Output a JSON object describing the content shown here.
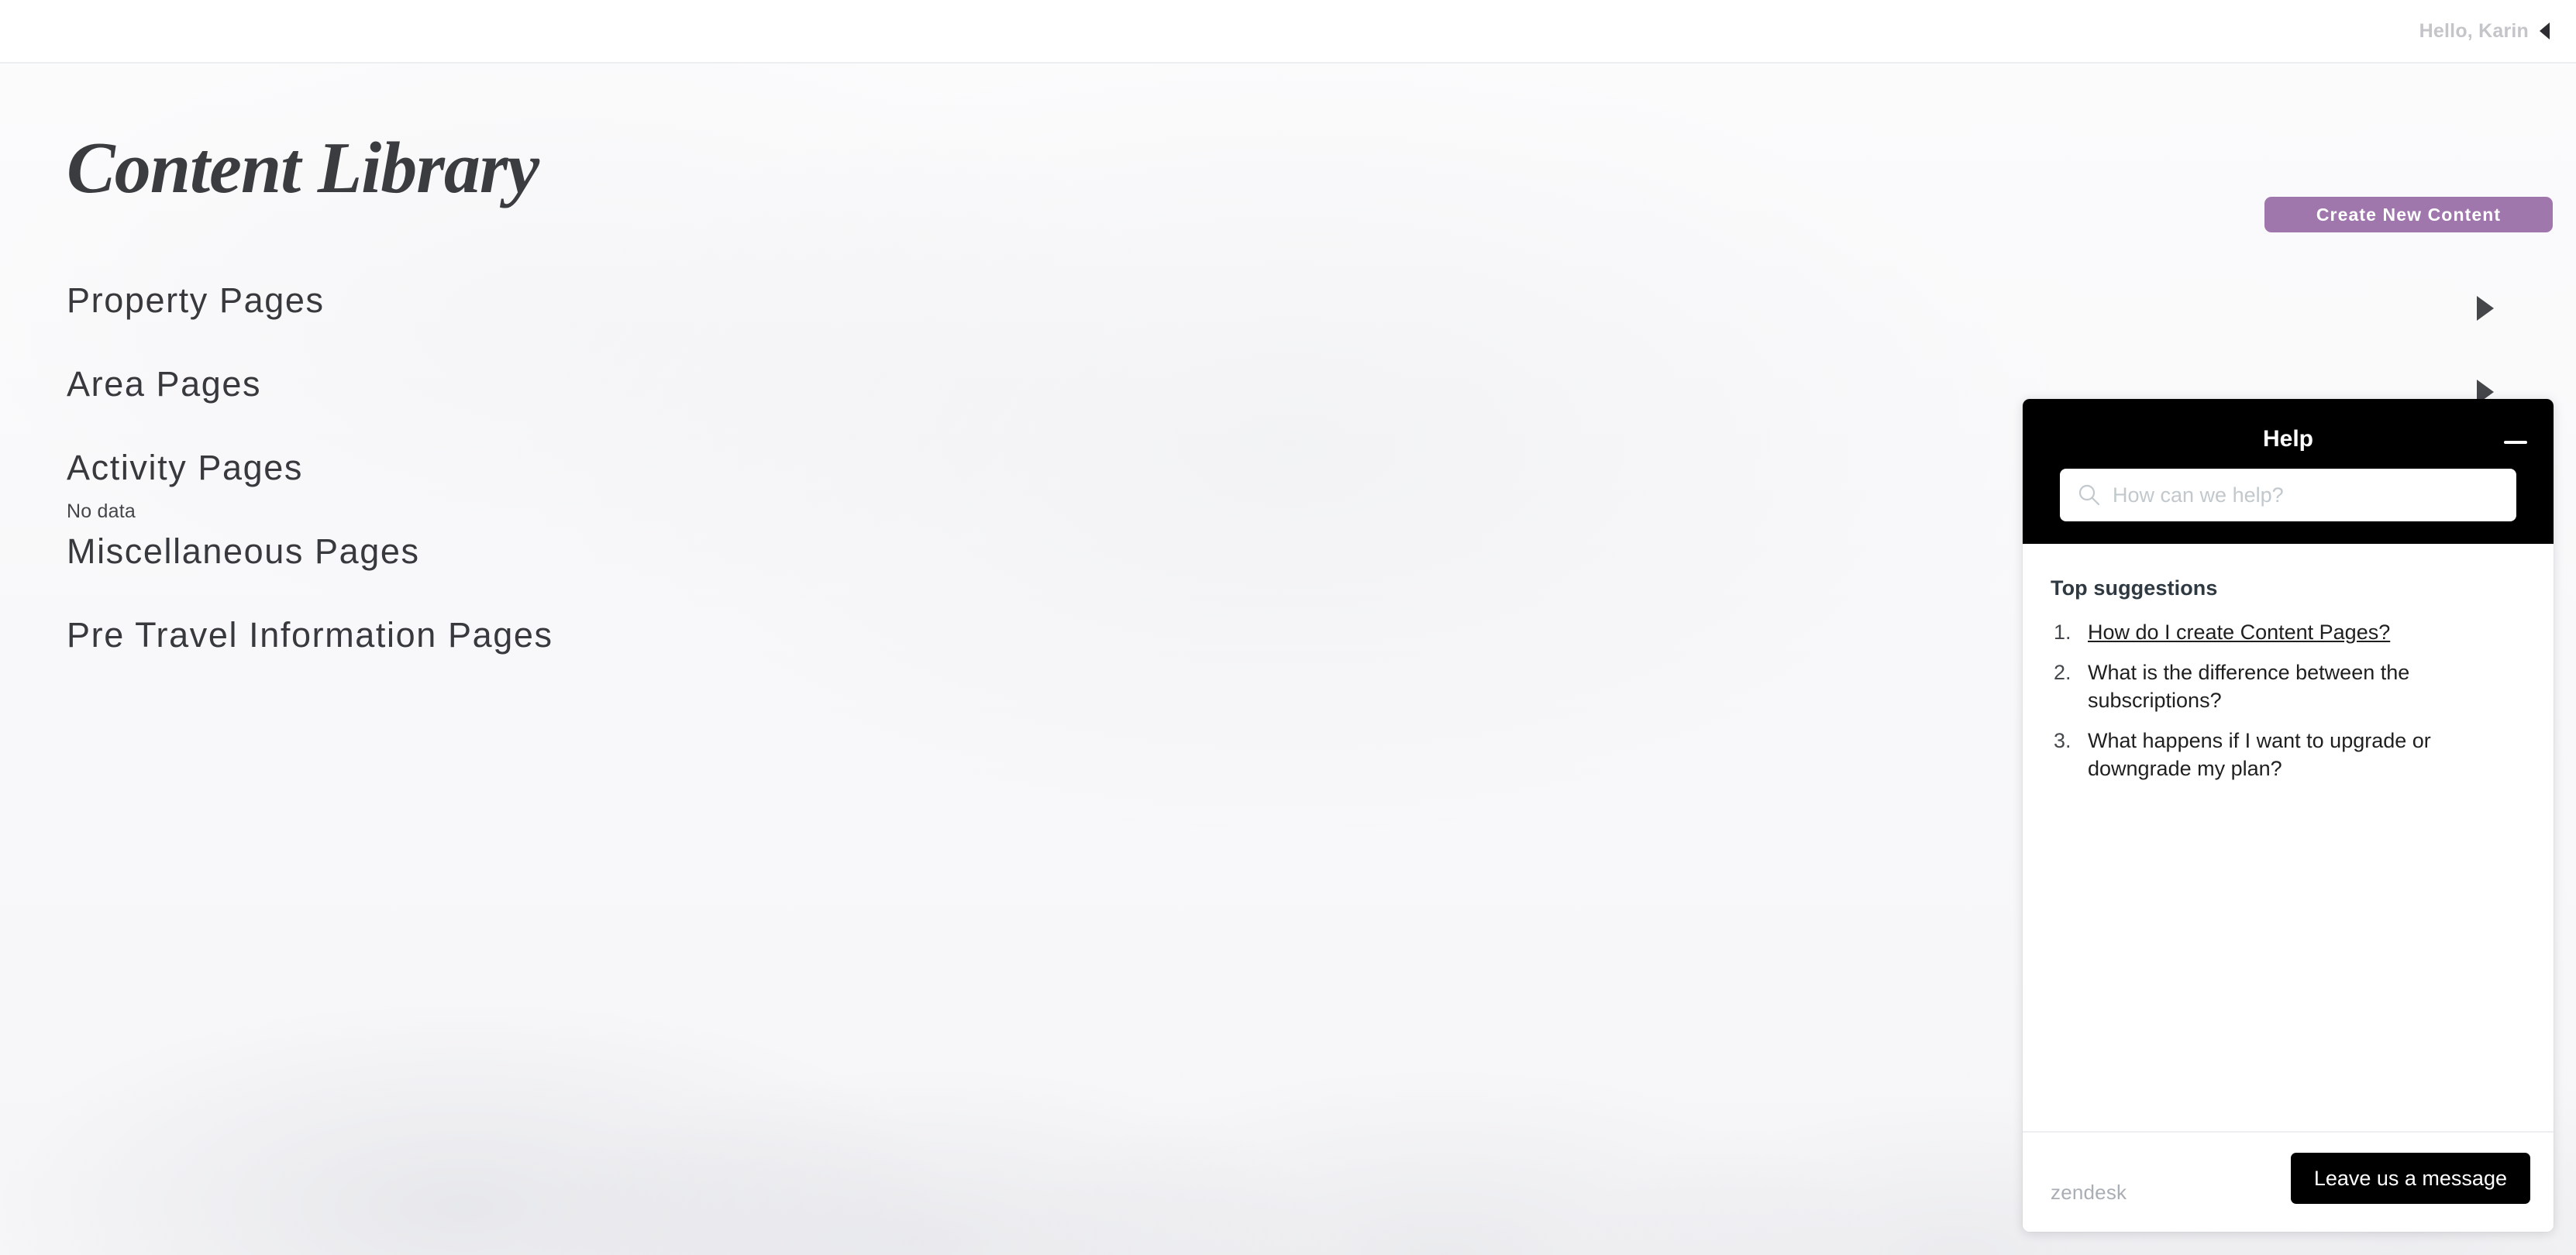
{
  "topbar": {
    "greeting": "Hello, Karin",
    "menu_caret_icon": "caret-left-icon"
  },
  "page": {
    "title": "Content Library"
  },
  "toolbar": {
    "create_label": "Create New Content",
    "accent_color": "#a077ad"
  },
  "categories": [
    {
      "label": "Property Pages",
      "empty_text": null,
      "expandable": true
    },
    {
      "label": "Area Pages",
      "empty_text": null,
      "expandable": true
    },
    {
      "label": "Activity Pages",
      "empty_text": "No data",
      "expandable": false
    },
    {
      "label": "Miscellaneous Pages",
      "empty_text": null,
      "expandable": false
    },
    {
      "label": "Pre Travel Information Pages",
      "empty_text": null,
      "expandable": false
    }
  ],
  "help_widget": {
    "title": "Help",
    "minimize_icon": "minimize-icon",
    "search": {
      "icon": "search-icon",
      "value": "",
      "placeholder": "How can we help?"
    },
    "suggestions_heading": "Top suggestions",
    "suggestions": [
      {
        "text": "How do I create Content Pages?",
        "is_link": true
      },
      {
        "text": "What is the difference between the subscriptions?",
        "is_link": false
      },
      {
        "text": "What happens if I want to upgrade or downgrade my plan?",
        "is_link": false
      }
    ],
    "footer": {
      "brand": "zendesk",
      "leave_message_label": "Leave us a message"
    }
  }
}
